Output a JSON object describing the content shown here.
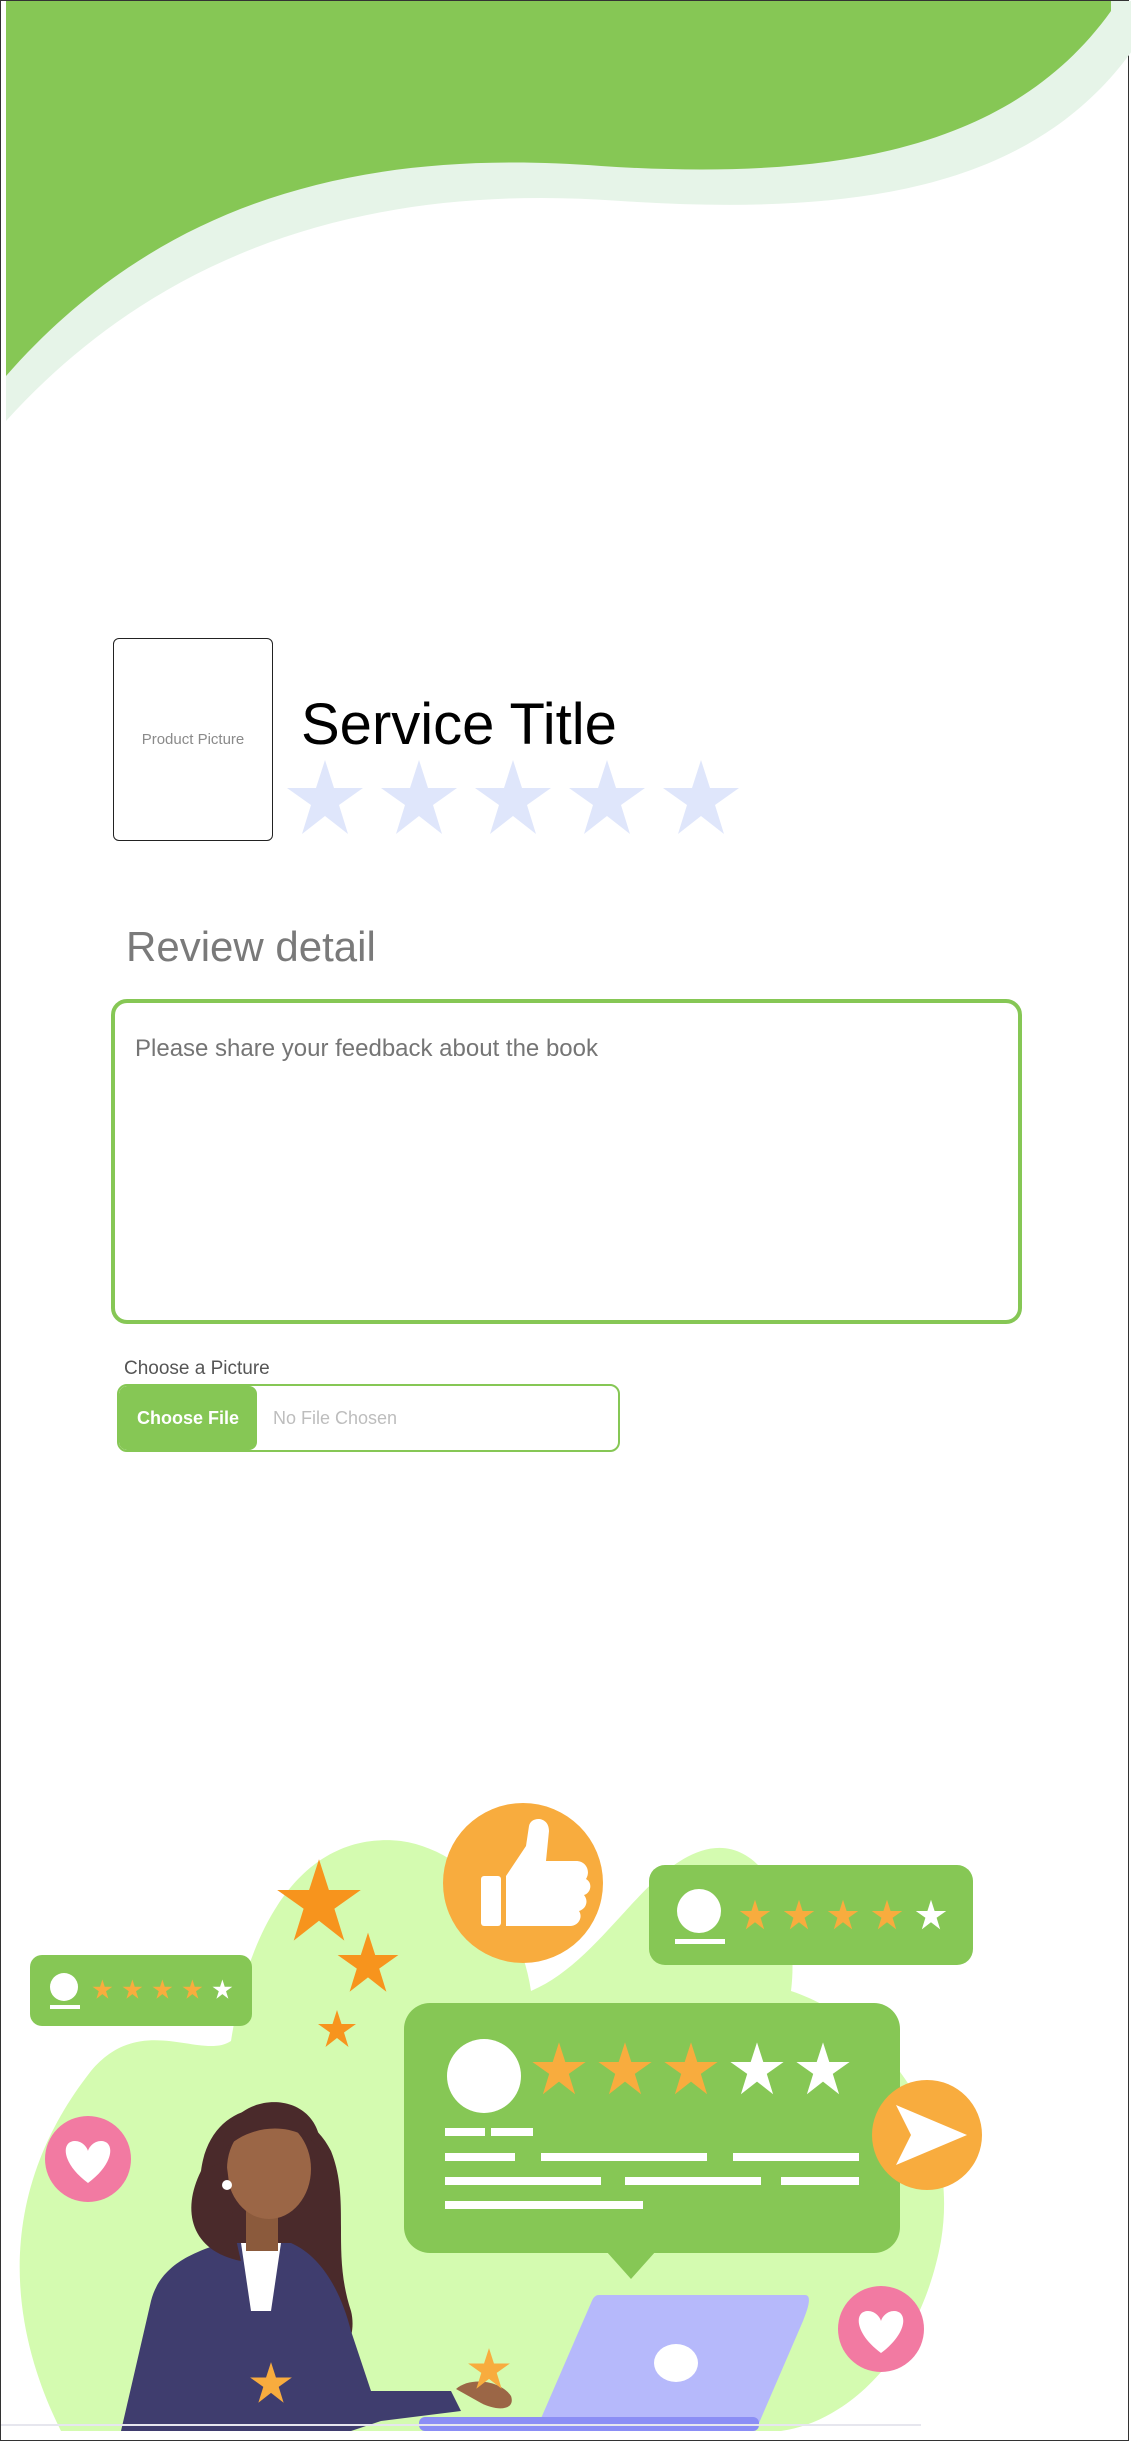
{
  "colors": {
    "brand_green": "#86c755",
    "light_green": "#d4fbb0",
    "pale_green": "#e6f4e8",
    "star_inactive": "#dfe6fb",
    "orange": "#f8ac3e",
    "star_orange": "#f7941d",
    "pink": "#f27aa2",
    "laptop": "#b6b9fb"
  },
  "product": {
    "picture_placeholder": "Product Picture",
    "service_title": "Service Title",
    "rating": {
      "value": 0,
      "max": 5
    }
  },
  "review": {
    "label": "Review detail",
    "placeholder": "Please share your feedback about the book"
  },
  "upload": {
    "label": "Choose a Picture",
    "button_label": "Choose File",
    "status_text": "No File Chosen"
  },
  "illustration": {
    "icons": [
      "thumbs-up-icon",
      "send-icon",
      "heart-icon",
      "star-icon",
      "user-icon"
    ],
    "main_card_rating": {
      "value": 3,
      "max": 5
    },
    "top_card_rating": {
      "value": 4,
      "max": 5
    },
    "left_card_rating": {
      "value": 4,
      "max": 5
    }
  }
}
